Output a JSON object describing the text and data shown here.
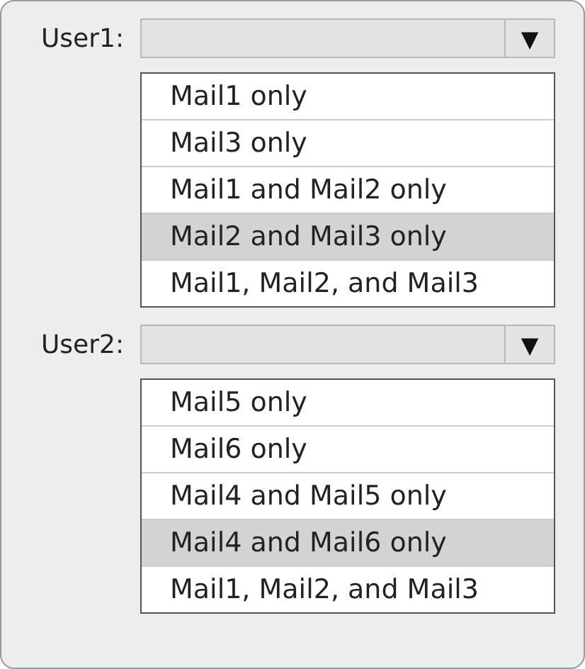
{
  "selects": [
    {
      "label": "User1:",
      "arrow": "▼",
      "options": [
        {
          "text": "Mail1 only",
          "selected": false
        },
        {
          "text": "Mail3 only",
          "selected": false
        },
        {
          "text": "Mail1 and Mail2 only",
          "selected": false
        },
        {
          "text": "Mail2 and Mail3 only",
          "selected": true
        },
        {
          "text": "Mail1, Mail2, and Mail3",
          "selected": false
        }
      ]
    },
    {
      "label": "User2:",
      "arrow": "▼",
      "options": [
        {
          "text": "Mail5 only",
          "selected": false
        },
        {
          "text": "Mail6 only",
          "selected": false
        },
        {
          "text": "Mail4 and Mail5 only",
          "selected": false
        },
        {
          "text": "Mail4 and Mail6 only",
          "selected": true
        },
        {
          "text": "Mail1, Mail2, and Mail3",
          "selected": false
        }
      ]
    }
  ]
}
